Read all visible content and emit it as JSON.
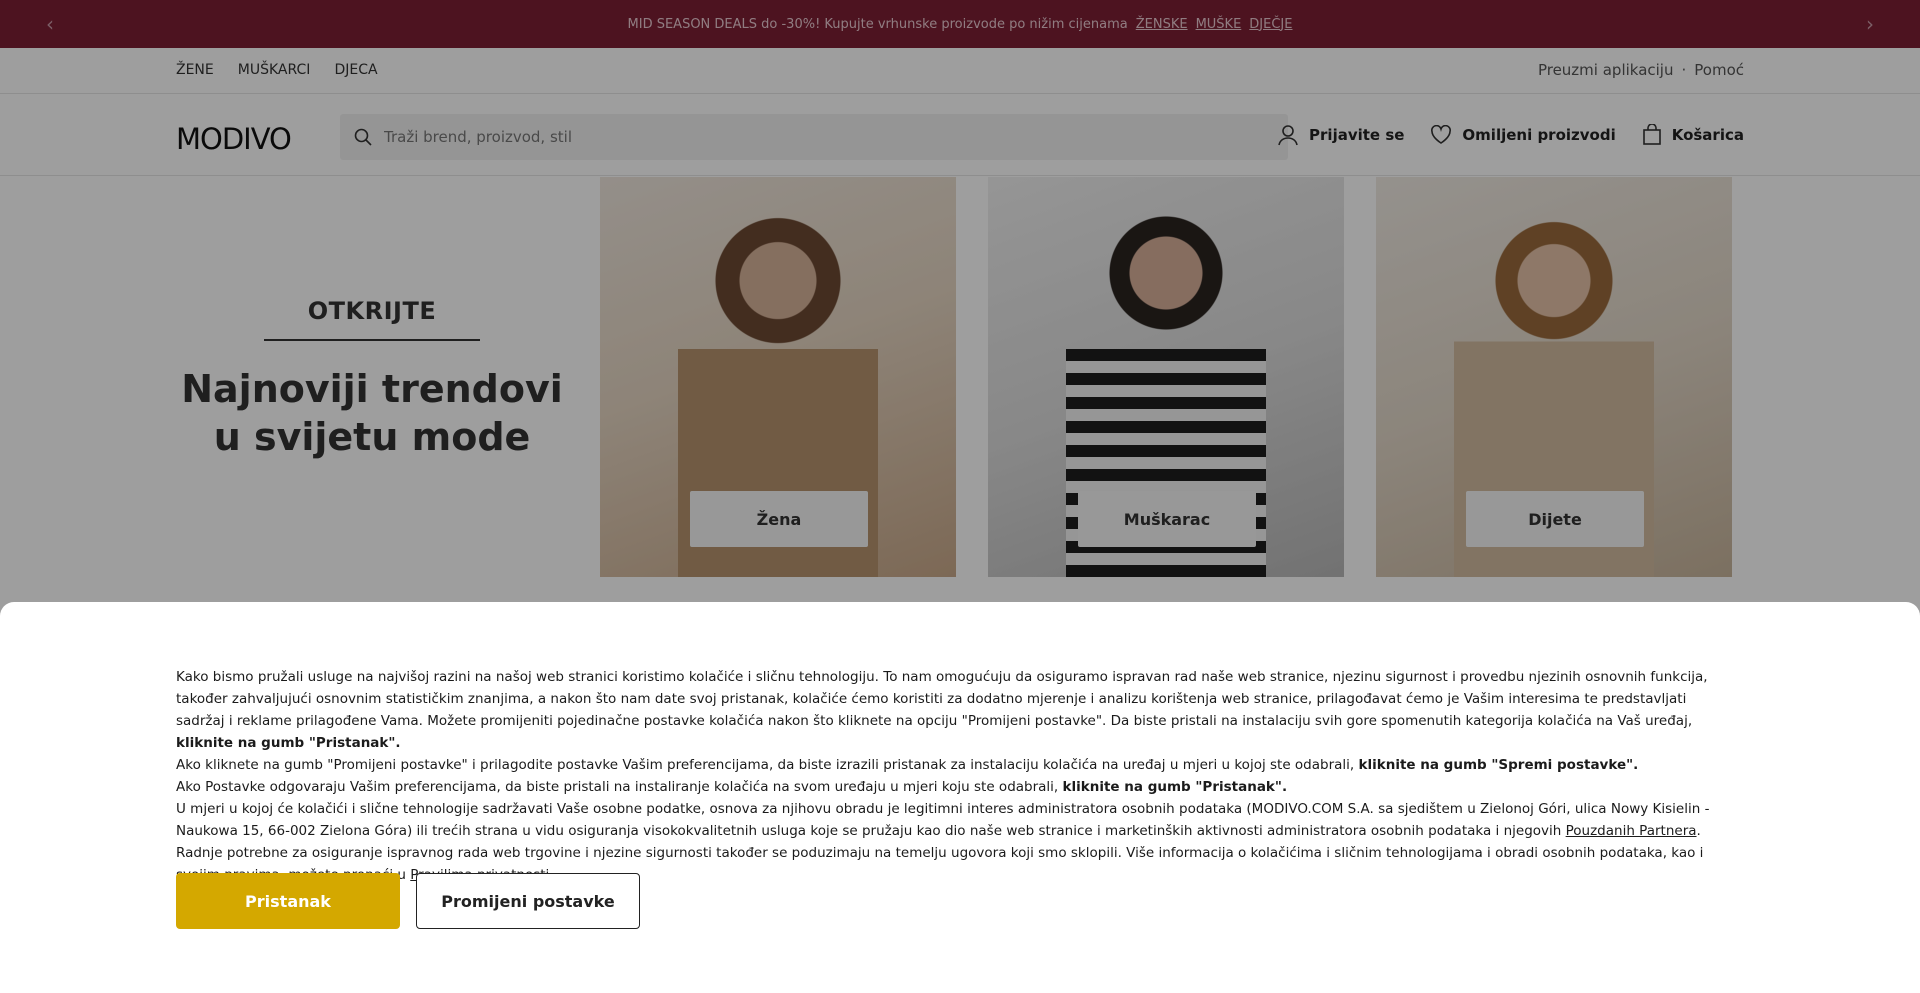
{
  "promo": {
    "text": "MID SEASON DEALS do -30%! Kupujte vrhunske proizvode po nižim cijenama",
    "links": [
      "ŽENSKE",
      "MUŠKE",
      "DJEČJE"
    ]
  },
  "topnav": {
    "left": [
      "ŽENE",
      "MUŠKARCI",
      "DJECA"
    ],
    "app_link": "Preuzmi aplikaciju",
    "separator": "·",
    "help_link": "Pomoć"
  },
  "header": {
    "logo": "MODIVO",
    "search_placeholder": "Traži brend, proizvod, stil",
    "login": "Prijavite se",
    "favorites": "Omiljeni proizvodi",
    "cart": "Košarica"
  },
  "hero": {
    "kicker": "OTKRIJTE",
    "title": "Najnoviji trendovi u svijetu mode",
    "cards": [
      {
        "label": "Žena"
      },
      {
        "label": "Muškarac"
      },
      {
        "label": "Dijete"
      }
    ]
  },
  "cookie": {
    "p1_a": "Kako bismo pružali usluge na najvišoj razini na našoj web stranici koristimo kolačiće i sličnu tehnologiju. To nam omogućuju da osiguramo ispravan rad naše web stranice, njezinu sigurnost i provedbu njezinih osnovnih funkcija, također zahvaljujući osnovnim statističkim znanjima, a nakon što nam date svoj pristanak, kolačiće ćemo koristiti za dodatno mjerenje i analizu korištenja web stranice, prilagođavat ćemo je Vašim interesima te predstavljati sadržaj i reklame prilagođene Vama. Možete promijeniti pojedinačne postavke kolačića nakon što kliknete na opciju \"Promijeni postavke\". Da biste pristali na instalaciju svih gore spomenutih kategorija kolačića na Vaš uređaj, ",
    "p1_b": "kliknite na gumb \"Pristanak\".",
    "p2_a": "Ako kliknete na gumb \"Promijeni postavke\" i prilagodite postavke Vašim preferencijama, da biste izrazili pristanak za instalaciju kolačića na uređaj u mjeri u kojoj ste odabrali, ",
    "p2_b": "kliknite na gumb \"Spremi postavke\".",
    "p3_a": "Ako Postavke odgovaraju Vašim preferencijama, da biste pristali na instaliranje kolačića na svom uređaju u mjeri koju ste odabrali, ",
    "p3_b": "kliknite na gumb \"Pristanak\".",
    "p4_a": "U mjeri u kojoj će kolačići i slične tehnologije sadržavati Vaše osobne podatke, osnova za njihovu obradu je legitimni interes administratora osobnih podataka (MODIVO.COM S.A. sa sjedištem u Zielonoj Góri, ulica Nowy Kisielin - Naukowa 15, 66-002 Zielona Góra) ili trećih strana u vidu osiguranja visokokvalitetnih usluga koje se pružaju kao dio naše web stranice i marketinških aktivnosti administratora osobnih podataka i njegovih ",
    "p4_link1": "Pouzdanih Partnera",
    "p4_b": ". Radnje potrebne za osiguranje ispravnog rada web trgovine i njezine sigurnosti također se poduzimaju na temelju ugovora koji smo sklopili. Više informacija o kolačićima i sličnim tehnologijama i obradi osobnih podataka, kao i svojim pravima, možete pronaći u ",
    "p4_link2": "Pravilima privatnosti",
    "p4_c": ".",
    "accept_label": "Pristanak",
    "settings_label": "Promijeni postavke"
  }
}
